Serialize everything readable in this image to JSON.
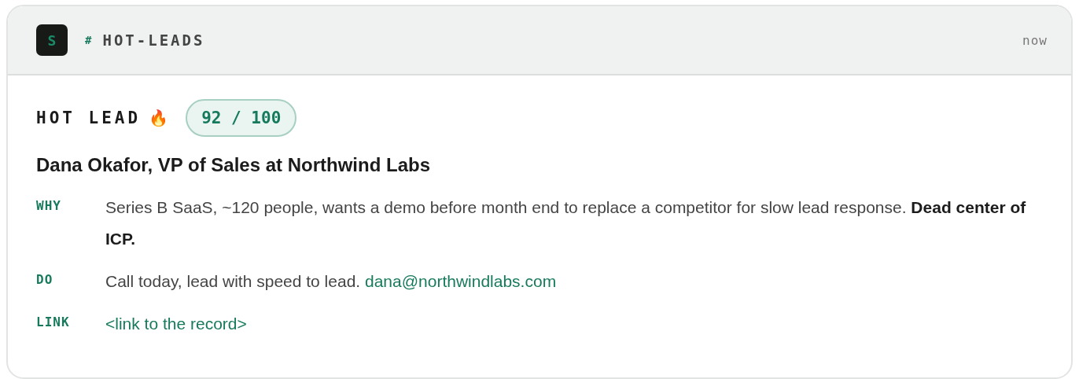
{
  "header": {
    "avatar": "S",
    "channel_mark": "#",
    "channel": "HOT-LEADS",
    "time": "now"
  },
  "lead": {
    "tag": "HOT LEAD",
    "emoji": "🔥",
    "score": "92 / 100",
    "title": "Dana Okafor, VP of Sales at Northwind Labs"
  },
  "details": [
    {
      "label": "WHY",
      "text": "Series B SaaS, ~120 people, wants a demo before month end to replace a competitor for slow lead response. **Dead center of ICP.**"
    },
    {
      "label": "DO",
      "text": "Call today, lead with speed to lead.",
      "link": "dana@northwindlabs.com"
    },
    {
      "label": "LINK",
      "link": "<link to the record>"
    }
  ]
}
